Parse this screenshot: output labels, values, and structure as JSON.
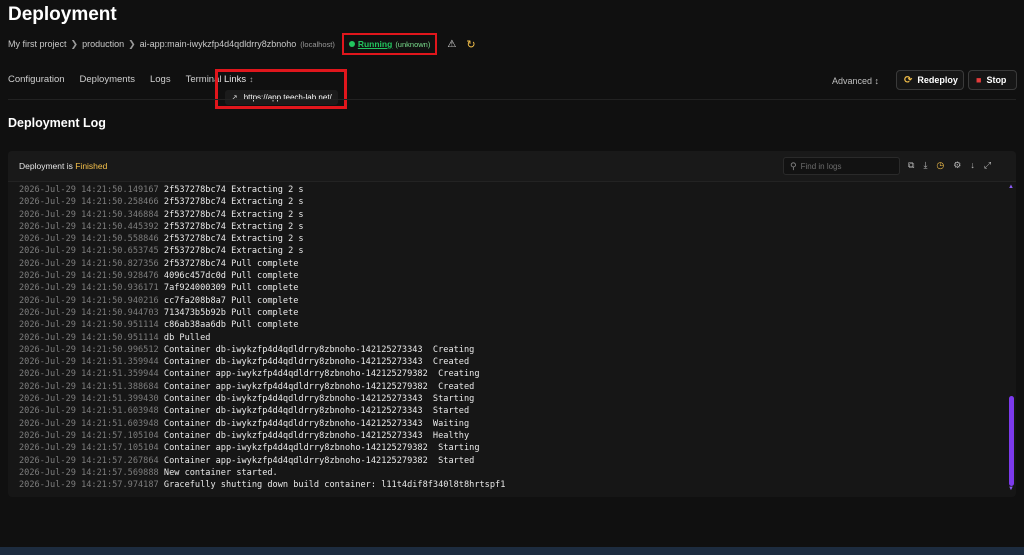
{
  "page": {
    "title": "Deployment"
  },
  "breadcrumb": {
    "project": "My first project",
    "environment": "production",
    "app": "ai-app:main-iwykzfp4d4qdldrry8zbnoho",
    "host": "(localhost)",
    "status": "Running",
    "status_detail": "(unknown)"
  },
  "tabs": [
    "Configuration",
    "Deployments",
    "Logs",
    "Terminal"
  ],
  "links": {
    "label": "Links",
    "url": "https://app.teech-lab.net/"
  },
  "actions": {
    "advanced": "Advanced",
    "redeploy": "Redeploy",
    "stop": "Stop"
  },
  "section": {
    "title": "Deployment Log"
  },
  "log": {
    "status_prefix": "Deployment is",
    "status_value": "Finished",
    "search_placeholder": "Find in logs",
    "lines": [
      {
        "ts": "2026-Jul-29 14:21:50.149167",
        "msg": "2f537278bc74 Extracting 2 s"
      },
      {
        "ts": "2026-Jul-29 14:21:50.258466",
        "msg": "2f537278bc74 Extracting 2 s"
      },
      {
        "ts": "2026-Jul-29 14:21:50.346884",
        "msg": "2f537278bc74 Extracting 2 s"
      },
      {
        "ts": "2026-Jul-29 14:21:50.445392",
        "msg": "2f537278bc74 Extracting 2 s"
      },
      {
        "ts": "2026-Jul-29 14:21:50.558846",
        "msg": "2f537278bc74 Extracting 2 s"
      },
      {
        "ts": "2026-Jul-29 14:21:50.653745",
        "msg": "2f537278bc74 Extracting 2 s"
      },
      {
        "ts": "2026-Jul-29 14:21:50.827356",
        "msg": "2f537278bc74 Pull complete"
      },
      {
        "ts": "2026-Jul-29 14:21:50.928476",
        "msg": "4096c457dc0d Pull complete"
      },
      {
        "ts": "2026-Jul-29 14:21:50.936171",
        "msg": "7af924000309 Pull complete"
      },
      {
        "ts": "2026-Jul-29 14:21:50.940216",
        "msg": "cc7fa208b8a7 Pull complete"
      },
      {
        "ts": "2026-Jul-29 14:21:50.944703",
        "msg": "713473b5b92b Pull complete"
      },
      {
        "ts": "2026-Jul-29 14:21:50.951114",
        "msg": "c86ab38aa6db Pull complete"
      },
      {
        "ts": "2026-Jul-29 14:21:50.951114",
        "msg": "db Pulled"
      },
      {
        "ts": "2026-Jul-29 14:21:50.996512",
        "msg": "Container db-iwykzfp4d4qdldrry8zbnoho-142125273343  Creating"
      },
      {
        "ts": "2026-Jul-29 14:21:51.359944",
        "msg": "Container db-iwykzfp4d4qdldrry8zbnoho-142125273343  Created"
      },
      {
        "ts": "2026-Jul-29 14:21:51.359944",
        "msg": "Container app-iwykzfp4d4qdldrry8zbnoho-142125279382  Creating"
      },
      {
        "ts": "2026-Jul-29 14:21:51.388684",
        "msg": "Container app-iwykzfp4d4qdldrry8zbnoho-142125279382  Created"
      },
      {
        "ts": "2026-Jul-29 14:21:51.399430",
        "msg": "Container db-iwykzfp4d4qdldrry8zbnoho-142125273343  Starting"
      },
      {
        "ts": "2026-Jul-29 14:21:51.603948",
        "msg": "Container db-iwykzfp4d4qdldrry8zbnoho-142125273343  Started"
      },
      {
        "ts": "2026-Jul-29 14:21:51.603948",
        "msg": "Container db-iwykzfp4d4qdldrry8zbnoho-142125273343  Waiting"
      },
      {
        "ts": "2026-Jul-29 14:21:57.105104",
        "msg": "Container db-iwykzfp4d4qdldrry8zbnoho-142125273343  Healthy"
      },
      {
        "ts": "2026-Jul-29 14:21:57.105104",
        "msg": "Container app-iwykzfp4d4qdldrry8zbnoho-142125279382  Starting"
      },
      {
        "ts": "2026-Jul-29 14:21:57.267864",
        "msg": "Container app-iwykzfp4d4qdldrry8zbnoho-142125279382  Started"
      },
      {
        "ts": "2026-Jul-29 14:21:57.569888",
        "msg": "New container started."
      },
      {
        "ts": "2026-Jul-29 14:21:57.974187",
        "msg": "Gracefully shutting down build container: l11t4dif8f340l8t8hrtspf1"
      }
    ]
  },
  "icons": {
    "warning": "warning-icon",
    "refresh": "refresh-icon",
    "external_link": "external-link-icon",
    "redeploy": "redeploy-icon",
    "stop": "stop-icon"
  },
  "colors": {
    "running": "#22c55e",
    "accent": "#f5c04a",
    "highlight": "#e0161c",
    "scrollbar": "#7c3aed"
  }
}
